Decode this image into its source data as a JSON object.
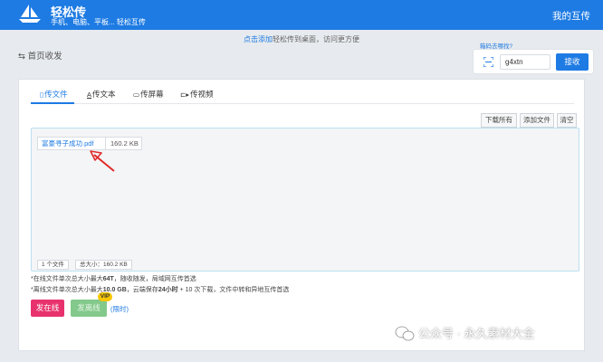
{
  "header": {
    "app_name": "轻松传",
    "subtitle": "手机、电脑、平板... 轻松互传",
    "my_link": "我的互传"
  },
  "notice": {
    "link": "点击添加",
    "text": "轻松传到桌面，访问更方便"
  },
  "breadcrumb": "⇆ 首页收发",
  "receive": {
    "help": "箱码去哪找?",
    "code_value": "g4xtn",
    "button": "接收"
  },
  "tabs": [
    {
      "icon": "file-icon",
      "label": "传文件",
      "active": true
    },
    {
      "icon": "text-icon",
      "label": "传文本",
      "active": false
    },
    {
      "icon": "screen-icon",
      "label": "传屏幕",
      "active": false
    },
    {
      "icon": "video-icon",
      "label": "传视频",
      "active": false
    }
  ],
  "tab_glyphs": {
    "file": "▯",
    "text": "A",
    "screen": "▭",
    "video": "⊏▸"
  },
  "tools": {
    "download_all": "下载所有",
    "add_file": "添加文件",
    "clear": "清空"
  },
  "file": {
    "name": "富豪寻子成功.pdf",
    "size": "160.2 KB"
  },
  "stats": {
    "count": "1 个文件",
    "total": "总大小：160.2 KB"
  },
  "notes": {
    "online_a": "*在线文件单次总大小最大",
    "online_b": "64T",
    "online_c": "，随收随发，局域网互传首选",
    "offline_a": "*离线文件单次总大小最大",
    "offline_b": "10.0 GB",
    "offline_c": "，云端保存",
    "offline_d": "24小时",
    "offline_e": " + 10 次下载，文件中转和异地互传首选"
  },
  "actions": {
    "online": "发在线",
    "offline": "发离线",
    "vip": "VIP",
    "limit": "(限时)"
  },
  "watermark": "公众号 · 永久素材大全",
  "colors": {
    "primary": "#1e7be3",
    "online_button": "#e8326e",
    "offline_button": "#83c98b",
    "vip_badge": "#f7c600",
    "arrow": "#e02b2b"
  }
}
